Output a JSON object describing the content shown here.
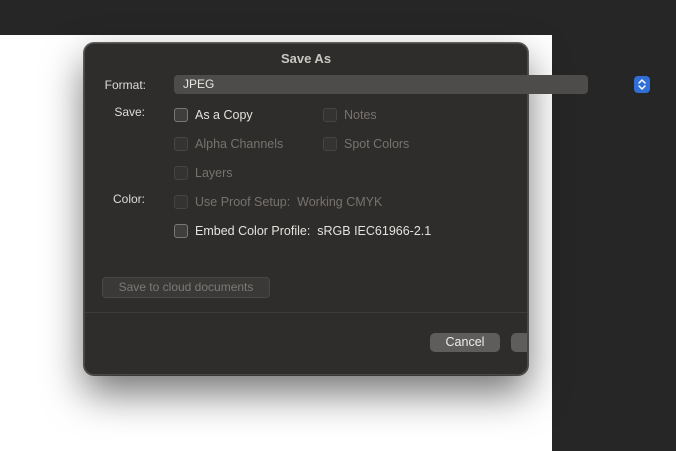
{
  "dialog": {
    "title": "Save As",
    "format": {
      "label": "Format:",
      "value": "JPEG"
    },
    "save": {
      "label": "Save:",
      "options": [
        {
          "label": "As a Copy",
          "checked": false,
          "enabled": true
        },
        {
          "label": "Notes",
          "checked": false,
          "enabled": false
        },
        {
          "label": "Alpha Channels",
          "checked": false,
          "enabled": false
        },
        {
          "label": "Spot Colors",
          "checked": false,
          "enabled": false
        },
        {
          "label": "Layers",
          "checked": false,
          "enabled": false
        }
      ]
    },
    "color": {
      "label": "Color:",
      "options": [
        {
          "label": "Use Proof Setup:  Working CMYK",
          "checked": false,
          "enabled": false
        },
        {
          "label": "Embed Color Profile:  sRGB IEC61966-2.1",
          "checked": false,
          "enabled": true
        }
      ]
    },
    "cloud_button": "Save to cloud documents",
    "cancel_button": "Cancel"
  }
}
